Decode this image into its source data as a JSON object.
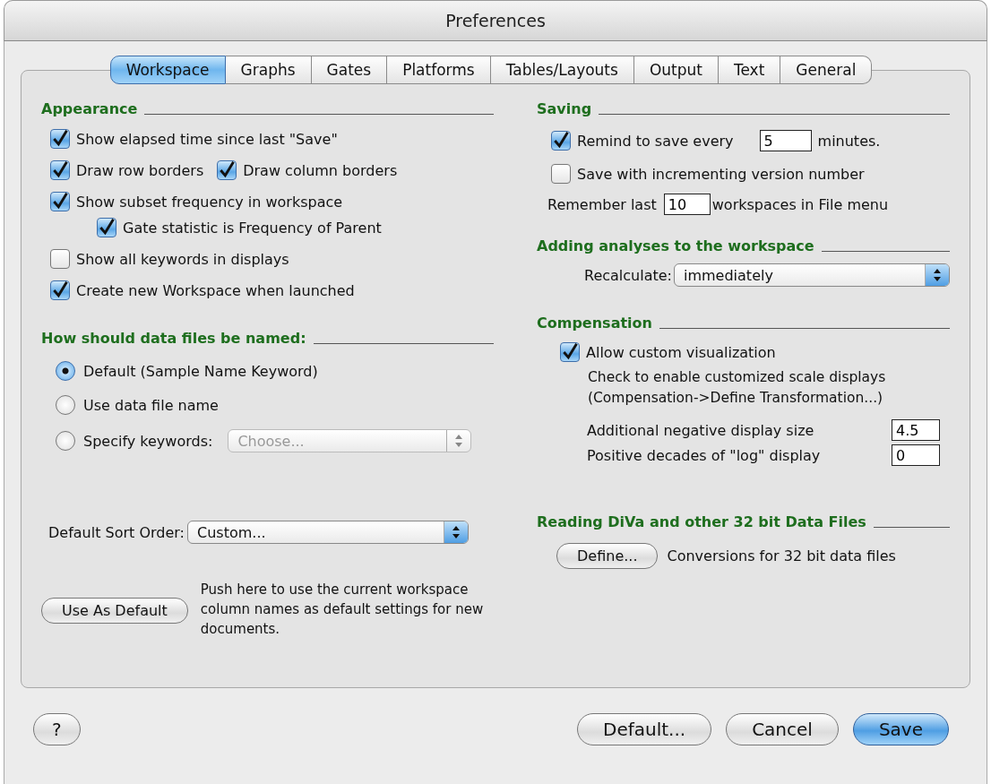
{
  "window": {
    "title": "Preferences"
  },
  "tabs": [
    {
      "label": "Workspace",
      "selected": true
    },
    {
      "label": "Graphs",
      "selected": false
    },
    {
      "label": "Gates",
      "selected": false
    },
    {
      "label": "Platforms",
      "selected": false
    },
    {
      "label": "Tables/Layouts",
      "selected": false
    },
    {
      "label": "Output",
      "selected": false
    },
    {
      "label": "Text",
      "selected": false
    },
    {
      "label": "General",
      "selected": false
    }
  ],
  "appearance": {
    "heading": "Appearance",
    "rows": [
      {
        "items": [
          {
            "label": "Show elapsed time since last \"Save\"",
            "checked": true
          }
        ]
      },
      {
        "items": [
          {
            "label": "Draw row borders",
            "checked": true
          },
          {
            "label": "Draw column borders",
            "checked": true
          }
        ]
      },
      {
        "items": [
          {
            "label": "Show subset frequency in workspace",
            "checked": true
          }
        ],
        "children": [
          {
            "items": [
              {
                "label": "Gate statistic is Frequency of Parent",
                "checked": true
              }
            ]
          }
        ]
      },
      {
        "items": [
          {
            "label": "Show all keywords in displays",
            "checked": false
          }
        ]
      },
      {
        "items": [
          {
            "label": "Create new Workspace when launched",
            "checked": true
          }
        ]
      }
    ]
  },
  "naming": {
    "heading": "How should data files be named:",
    "options": [
      {
        "label": "Default (Sample Name Keyword)",
        "selected": true
      },
      {
        "label": "Use data file name",
        "selected": false
      },
      {
        "label": "Specify keywords:",
        "selected": false,
        "popup": {
          "value": "Choose...",
          "disabled": true
        }
      }
    ]
  },
  "sort_order": {
    "label": "Default Sort Order:",
    "value": "Custom..."
  },
  "use_as_default": {
    "button": "Use As Default",
    "note": "Push here to use the current workspace column names as default settings for new documents."
  },
  "saving": {
    "heading": "Saving",
    "remind": {
      "label": "Remind to save every",
      "checked": true,
      "value": "5",
      "unit": "minutes."
    },
    "increment": {
      "label": "Save with incrementing version number",
      "checked": false
    },
    "remember": {
      "label": "Remember last",
      "value": "10",
      "suffix": "workspaces in File menu"
    }
  },
  "adding": {
    "heading": "Adding analyses to the workspace",
    "label": "Recalculate:",
    "value": "immediately"
  },
  "compensation": {
    "heading": "Compensation",
    "option": {
      "label": "Allow custom visualization",
      "checked": true
    },
    "note": [
      "Check to enable customized scale displays",
      "(Compensation->Define Transformation...)"
    ],
    "fields": [
      {
        "label": "Additional negative display size",
        "value": "4.5"
      },
      {
        "label": "Positive decades of \"log\" display",
        "value": "0"
      }
    ]
  },
  "reading": {
    "heading": "Reading DiVa and other 32 bit Data Files",
    "button": "Define...",
    "note": "Conversions for 32 bit data files"
  },
  "footer": {
    "help": "?",
    "buttons": [
      {
        "label": "Default...",
        "kind": "normal"
      },
      {
        "label": "Cancel",
        "kind": "normal"
      },
      {
        "label": "Save",
        "kind": "default"
      }
    ]
  }
}
